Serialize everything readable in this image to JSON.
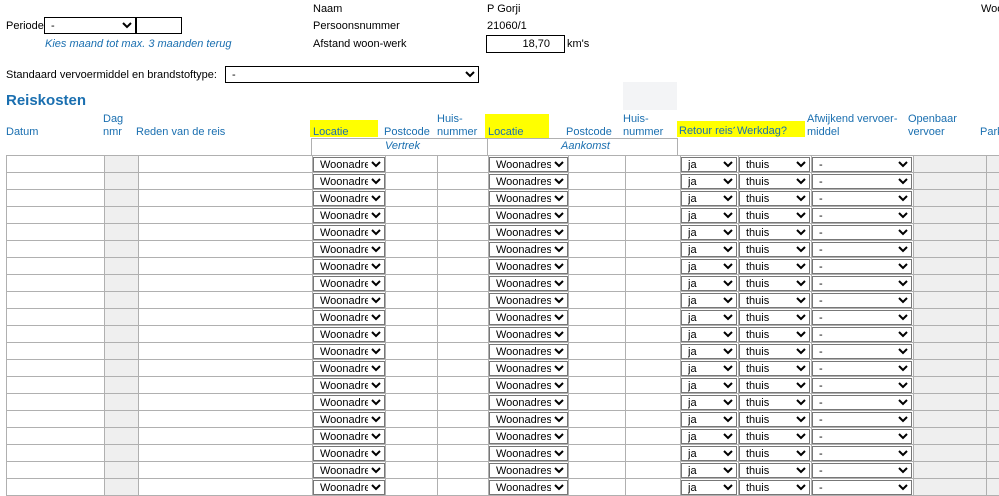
{
  "top": {
    "periode_label": "Periode",
    "periode_value": "-",
    "periode_input": "",
    "periode_hint": "Kies maand tot max. 3 maanden terug",
    "naam_label": "Naam",
    "naam_value": "P  Gorji",
    "persoonsnummer_label": "Persoonsnummer",
    "persoonsnummer_value": "21060/1",
    "afstand_label": "Afstand woon-werk",
    "afstand_value": "18,70",
    "afstand_unit": "km's",
    "right_cut": "Woo",
    "standaard_label": "Standaard vervoermiddel en brandstoftype:",
    "standaard_value": "-"
  },
  "section_title": "Reiskosten",
  "headers": {
    "datum": "Datum",
    "dag_nmr_1": "Dag",
    "dag_nmr_2": "nmr",
    "reden": "Reden van de reis",
    "locatie_vertrek": "Locatie",
    "postcode_vertrek": "Postcode",
    "huisnummer_vertrek_1": "Huis-",
    "huisnummer_vertrek_2": "nummer",
    "locatie_aankomst": "Locatie",
    "postcode_aankomst": "Postcode",
    "huisnummer_aankomst_1": "Huis-",
    "huisnummer_aankomst_2": "nummer",
    "retour": "Retour reis?",
    "werkdag": "Werkdag?",
    "afwijkend_1": "Afwijkend vervoer-",
    "afwijkend_2": "middel",
    "openbaar_1": "Openbaar",
    "openbaar_2": "vervoer",
    "park": "Park",
    "vertrek": "Vertrek",
    "aankomst": "Aankomst"
  },
  "row_defaults": {
    "locatie_vertrek": "Woonadres",
    "locatie_aankomst": "Woonadres",
    "retour": "ja",
    "werkdag": "thuis",
    "afwijkend": "-"
  },
  "row_count": 20
}
